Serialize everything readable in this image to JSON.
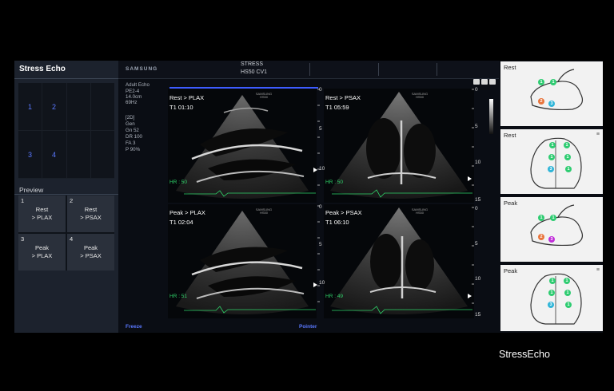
{
  "app_title": "Stress Echo",
  "brand": "SAMSUNG",
  "header": {
    "line1": "STRESS",
    "line2": "HS50 CV1"
  },
  "params": [
    "Adult Echo",
    "PE2-4",
    "14.0cm",
    "69Hz",
    "",
    "[2D]",
    "Gen",
    "Gn    52",
    "DR    100",
    "FA    3",
    "P     90%"
  ],
  "layout_grid": [
    "1",
    "2",
    "3",
    "4"
  ],
  "preview": {
    "label": "Preview",
    "cells": [
      {
        "num": "1",
        "line1": "Rest",
        "line2": "> PLAX"
      },
      {
        "num": "2",
        "line1": "Rest",
        "line2": "> PSAX"
      },
      {
        "num": "3",
        "line1": "Peak",
        "line2": "> PLAX"
      },
      {
        "num": "4",
        "line1": "Peak",
        "line2": "> PSAX"
      }
    ]
  },
  "views": [
    {
      "title": "Rest > PLAX",
      "time": "T1 01:10",
      "hr": "HR : 50"
    },
    {
      "title": "Rest > PSAX",
      "time": "T1 05:59",
      "hr": "HR : 50"
    },
    {
      "title": "Peak > PLAX",
      "time": "T1 02:04",
      "hr": "HR : 51"
    },
    {
      "title": "Peak > PSAX",
      "time": "T1 06:10",
      "hr": "HR : 49"
    }
  ],
  "watermark": {
    "line1": "SAMSUNG",
    "line2": "HS50"
  },
  "ruler_center": {
    "top": "0",
    "mid": "5",
    "bottom": "10"
  },
  "ruler_right": {
    "top": "0",
    "mid": "5",
    "bottom": "10",
    "end": "15"
  },
  "status": {
    "freeze": "Freeze",
    "pointer": "Pointer"
  },
  "bullseye": [
    {
      "title": "Rest",
      "menu": "",
      "segments": [
        {
          "n": "1",
          "color": "#2ecc71"
        },
        {
          "n": "1",
          "color": "#2ecc71"
        },
        {
          "n": "2",
          "color": "#e8743b"
        },
        {
          "n": "3",
          "color": "#2fb5d8"
        }
      ]
    },
    {
      "title": "Rest",
      "menu": "≡",
      "segments": [
        {
          "n": "1",
          "color": "#2ecc71"
        },
        {
          "n": "1",
          "color": "#2ecc71"
        },
        {
          "n": "1",
          "color": "#2ecc71"
        },
        {
          "n": "1",
          "color": "#2ecc71"
        },
        {
          "n": "3",
          "color": "#2fb5d8"
        },
        {
          "n": "1",
          "color": "#2ecc71"
        }
      ]
    },
    {
      "title": "Peak",
      "menu": "",
      "segments": [
        {
          "n": "1",
          "color": "#2ecc71"
        },
        {
          "n": "1",
          "color": "#2ecc71"
        },
        {
          "n": "2",
          "color": "#e8743b"
        },
        {
          "n": "3",
          "color": "#c02bd9"
        }
      ]
    },
    {
      "title": "Peak",
      "menu": "≡",
      "segments": [
        {
          "n": "1",
          "color": "#2ecc71"
        },
        {
          "n": "1",
          "color": "#2ecc71"
        },
        {
          "n": "1",
          "color": "#2ecc71"
        },
        {
          "n": "1",
          "color": "#2ecc71"
        },
        {
          "n": "3",
          "color": "#2fb5d8"
        },
        {
          "n": "1",
          "color": "#2ecc71"
        }
      ]
    }
  ],
  "caption": "StressEcho",
  "colors": {
    "accent": "#3d5cff",
    "hr_trace": "#2fd46a",
    "panel": "#1c222d"
  }
}
